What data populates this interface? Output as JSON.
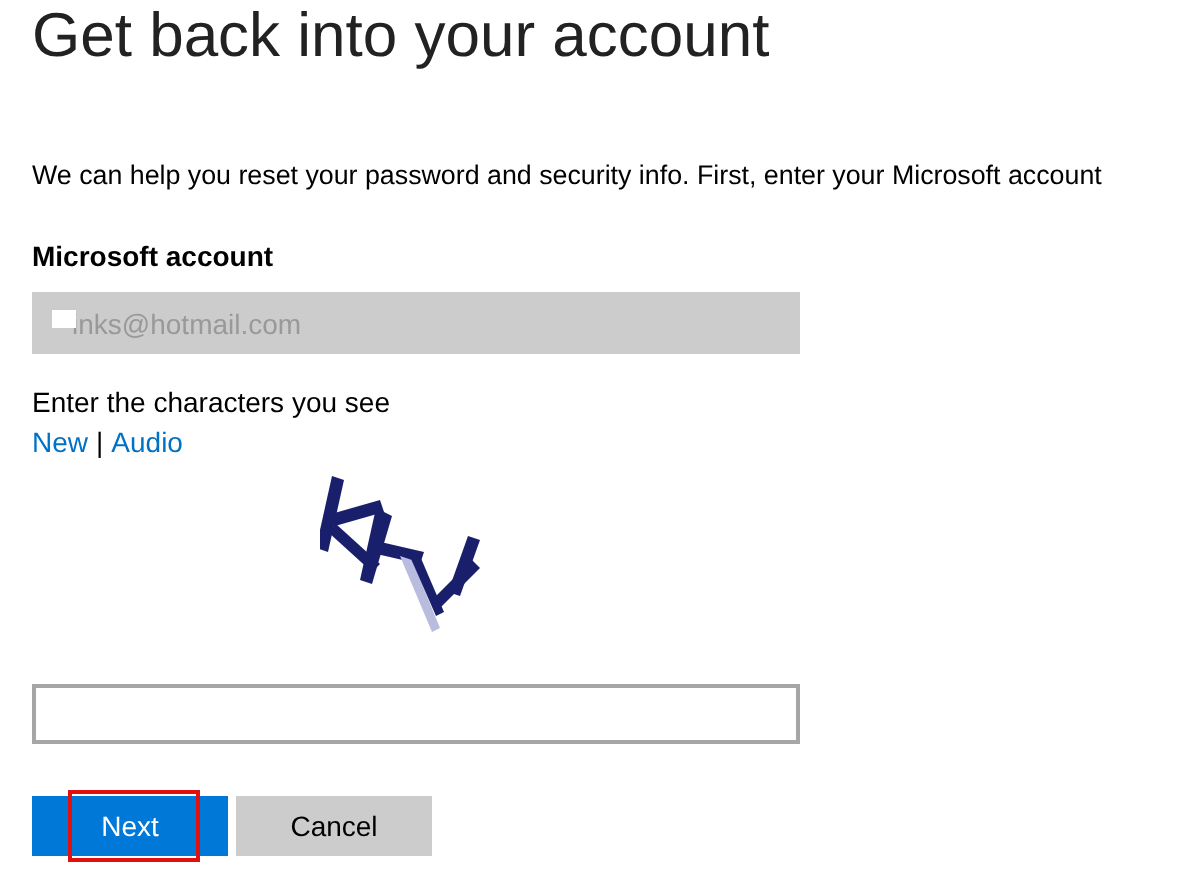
{
  "title": "Get back into your account",
  "intro": "We can help you reset your password and security info. First, enter your Microsoft account",
  "account": {
    "label": "Microsoft account",
    "value": "inks@hotmail.com",
    "disabled": true,
    "redacted": true
  },
  "captcha": {
    "prompt": "Enter the characters you see",
    "links": [
      {
        "label": "New"
      },
      {
        "label": "Audio"
      }
    ],
    "separator": "|"
  },
  "buttons": [
    {
      "label": "Next",
      "kind": "primary",
      "highlighted": true
    },
    {
      "label": "Cancel",
      "kind": "secondary",
      "highlighted": false
    }
  ]
}
